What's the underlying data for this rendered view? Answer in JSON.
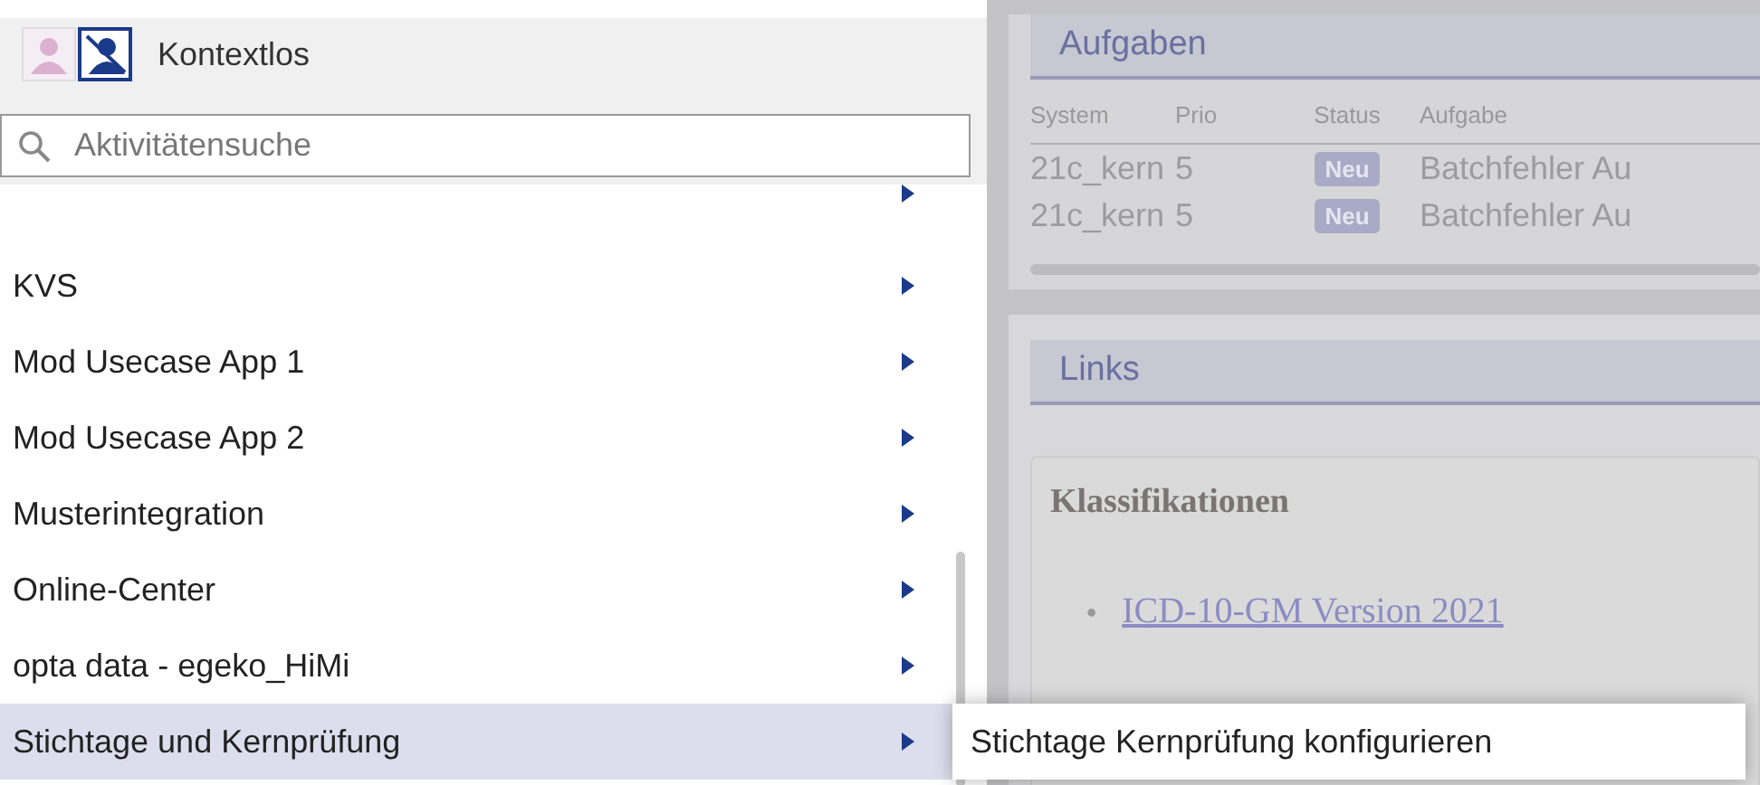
{
  "context": {
    "label": "Kontextlos"
  },
  "search": {
    "placeholder": "Aktivitätensuche"
  },
  "menu_items": [
    {
      "label": "KVS",
      "selected": false
    },
    {
      "label": "Mod Usecase App 1",
      "selected": false
    },
    {
      "label": "Mod Usecase App 2",
      "selected": false
    },
    {
      "label": "Musterintegration",
      "selected": false
    },
    {
      "label": "Online-Center",
      "selected": false
    },
    {
      "label": "opta data - egeko_HiMi",
      "selected": false
    },
    {
      "label": "Stichtage und Kernprüfung",
      "selected": true
    }
  ],
  "submenu": {
    "items": [
      "Stichtage Kernprüfung konfigurieren"
    ]
  },
  "tasks": {
    "title": "Aufgaben",
    "columns": [
      "System",
      "Prio",
      "Status",
      "Aufgabe"
    ],
    "rows": [
      {
        "system": "21c_kern",
        "prio": "5",
        "status": "Neu",
        "task": "Batchfehler Au"
      },
      {
        "system": "21c_kern",
        "prio": "5",
        "status": "Neu",
        "task": "Batchfehler Au"
      }
    ]
  },
  "links": {
    "title": "Links",
    "section": "Klassifikationen",
    "items": [
      {
        "bullet": "•",
        "text": "ICD-10-GM Version 2021"
      }
    ]
  }
}
